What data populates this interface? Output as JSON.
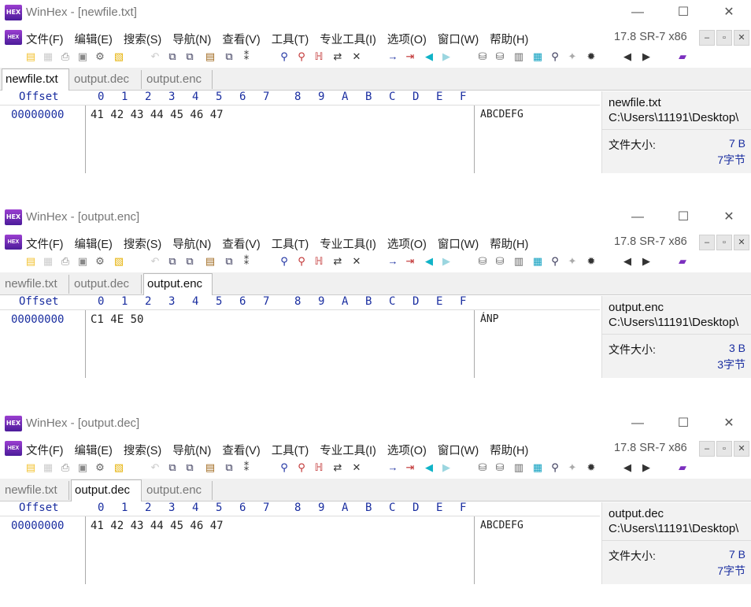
{
  "windows": [
    {
      "title": "WinHex - [newfile.txt]",
      "menu": [
        "文件(F)",
        "编辑(E)",
        "搜索(S)",
        "导航(N)",
        "查看(V)",
        "工具(T)",
        "专业工具(I)",
        "选项(O)",
        "窗口(W)",
        "帮助(H)"
      ],
      "version": "17.8 SR-7 x86",
      "tabs": [
        {
          "label": "newfile.txt",
          "active": true
        },
        {
          "label": "output.dec",
          "active": false
        },
        {
          "label": "output.enc",
          "active": false
        }
      ],
      "offset_header": "Offset",
      "columns": [
        "0",
        "1",
        "2",
        "3",
        "4",
        "5",
        "6",
        "7",
        "8",
        "9",
        "A",
        "B",
        "C",
        "D",
        "E",
        "F"
      ],
      "row_offset": "00000000",
      "hex_bytes": "41 42 43 44 45 46 47",
      "ascii": "ABCDEFG",
      "info": {
        "filename": "newfile.txt",
        "path": "C:\\Users\\11191\\Desktop\\",
        "size_label": "文件大小:",
        "size": "7 B",
        "size_bytes": "7字节"
      }
    },
    {
      "title": "WinHex - [output.enc]",
      "menu": [
        "文件(F)",
        "编辑(E)",
        "搜索(S)",
        "导航(N)",
        "查看(V)",
        "工具(T)",
        "专业工具(I)",
        "选项(O)",
        "窗口(W)",
        "帮助(H)"
      ],
      "version": "17.8 SR-7 x86",
      "tabs": [
        {
          "label": "newfile.txt",
          "active": false
        },
        {
          "label": "output.dec",
          "active": false
        },
        {
          "label": "output.enc",
          "active": true
        }
      ],
      "offset_header": "Offset",
      "columns": [
        "0",
        "1",
        "2",
        "3",
        "4",
        "5",
        "6",
        "7",
        "8",
        "9",
        "A",
        "B",
        "C",
        "D",
        "E",
        "F"
      ],
      "row_offset": "00000000",
      "hex_bytes": "C1 4E 50",
      "ascii": "ÁNP",
      "info": {
        "filename": "output.enc",
        "path": "C:\\Users\\11191\\Desktop\\",
        "size_label": "文件大小:",
        "size": "3 B",
        "size_bytes": "3字节"
      }
    },
    {
      "title": "WinHex - [output.dec]",
      "menu": [
        "文件(F)",
        "编辑(E)",
        "搜索(S)",
        "导航(N)",
        "查看(V)",
        "工具(T)",
        "专业工具(I)",
        "选项(O)",
        "窗口(W)",
        "帮助(H)"
      ],
      "version": "17.8 SR-7 x86",
      "tabs": [
        {
          "label": "newfile.txt",
          "active": false
        },
        {
          "label": "output.dec",
          "active": true
        },
        {
          "label": "output.enc",
          "active": false
        }
      ],
      "offset_header": "Offset",
      "columns": [
        "0",
        "1",
        "2",
        "3",
        "4",
        "5",
        "6",
        "7",
        "8",
        "9",
        "A",
        "B",
        "C",
        "D",
        "E",
        "F"
      ],
      "row_offset": "00000000",
      "hex_bytes": "41 42 43 44 45 46 47",
      "ascii": "ABCDEFG",
      "info": {
        "filename": "output.dec",
        "path": "C:\\Users\\11191\\Desktop\\",
        "size_label": "文件大小:",
        "size": "7 B",
        "size_bytes": "7字节"
      }
    }
  ],
  "app_icon_text": "HEX",
  "window_controls": [
    "—",
    "☐",
    "✕"
  ],
  "mdi_controls": [
    "–",
    "▫",
    "✕"
  ],
  "colors": {
    "hex_blue": "#1a2ea0",
    "accent_cyan": "#10b3c7",
    "icon_purple": "#7b2fbf"
  }
}
